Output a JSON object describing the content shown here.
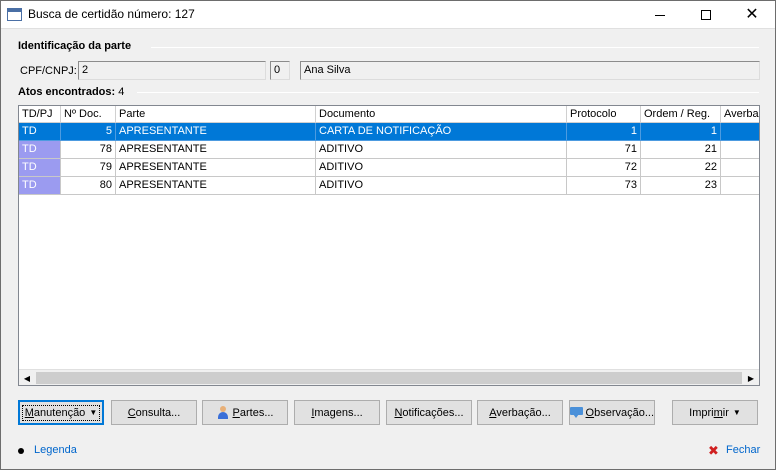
{
  "window": {
    "title": "Busca de certidão número: 127",
    "minimize_glyph": "",
    "close_glyph": "✕"
  },
  "identification": {
    "group_label": "Identificação da parte",
    "cpf_label": "CPF/CNPJ:",
    "cpf_value": "2",
    "code_value": "0",
    "name_value": "Ana Silva"
  },
  "acts": {
    "label": "Atos encontrados:",
    "count": "4"
  },
  "grid": {
    "columns": [
      "TD/PJ",
      "Nº Doc.",
      "Parte",
      "Documento",
      "Protocolo",
      "Ordem / Reg.",
      "Averbaç"
    ],
    "rows": [
      {
        "tdpj": "TD",
        "doc": "5",
        "parte": "APRESENTANTE",
        "documento": "CARTA DE NOTIFICAÇÃO",
        "protocolo": "1",
        "ordem": "1",
        "averb": "",
        "selected": true
      },
      {
        "tdpj": "TD",
        "doc": "78",
        "parte": "APRESENTANTE",
        "documento": "ADITIVO",
        "protocolo": "71",
        "ordem": "21",
        "averb": "",
        "selected": false
      },
      {
        "tdpj": "TD",
        "doc": "79",
        "parte": "APRESENTANTE",
        "documento": "ADITIVO",
        "protocolo": "72",
        "ordem": "22",
        "averb": "",
        "selected": false
      },
      {
        "tdpj": "TD",
        "doc": "80",
        "parte": "APRESENTANTE",
        "documento": "ADITIVO",
        "protocolo": "73",
        "ordem": "23",
        "averb": "",
        "selected": false
      }
    ],
    "scroll_left_icon": "◀",
    "scroll_right_icon": "▶"
  },
  "buttons": {
    "manutencao": {
      "pre": "",
      "ul": "M",
      "post": "anutenção"
    },
    "consulta": {
      "pre": "",
      "ul": "C",
      "post": "onsulta..."
    },
    "partes": {
      "pre": "",
      "ul": "P",
      "post": "artes..."
    },
    "imagens": {
      "pre": "",
      "ul": "I",
      "post": "magens..."
    },
    "notificacoes": {
      "pre": "",
      "ul": "N",
      "post": "otificações..."
    },
    "averbacao": {
      "pre": "",
      "ul": "A",
      "post": "verbação..."
    },
    "observacao": {
      "pre": "",
      "ul": "O",
      "post": "bservação..."
    },
    "imprimir": {
      "pre": "Impri",
      "ul": "m",
      "post": "ir"
    },
    "dropdown_caret": "▼"
  },
  "footer": {
    "legend_label": "Legenda",
    "close_label": "Fechar",
    "close_icon": "✖"
  },
  "colors": {
    "selection": "#0078d7",
    "td_cell": "#9b9bf0",
    "link": "#0066cc",
    "close_icon": "#d02020"
  }
}
